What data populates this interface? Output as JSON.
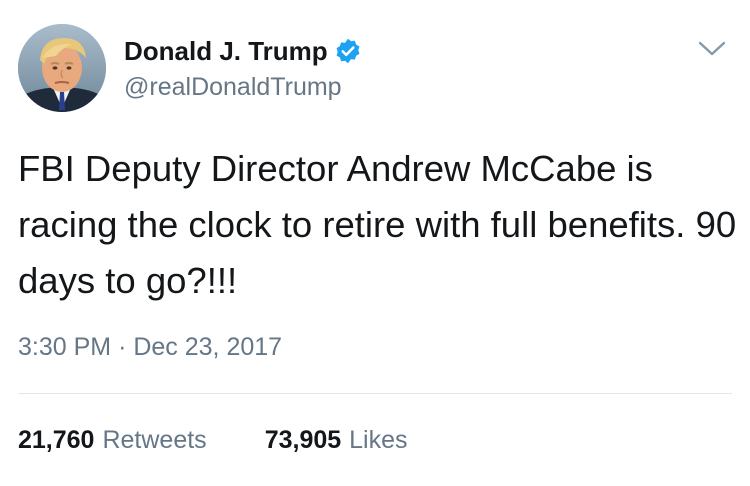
{
  "user": {
    "display_name": "Donald J. Trump",
    "handle": "@realDonaldTrump",
    "verified": true
  },
  "tweet": {
    "text": "FBI Deputy Director Andrew McCabe is racing the clock to retire with full benefits. 90 days to go?!!!",
    "time": "3:30 PM",
    "separator": "·",
    "date": "Dec 23, 2017"
  },
  "stats": {
    "retweets_count": "21,760",
    "retweets_label": "Retweets",
    "likes_count": "73,905",
    "likes_label": "Likes"
  },
  "colors": {
    "verified_blue": "#1da1f2",
    "secondary_text": "#657786",
    "primary_text": "#14171a",
    "divider": "#e1e8ed"
  },
  "icons": {
    "verified": "verified-badge-icon",
    "caret": "chevron-down-icon"
  }
}
